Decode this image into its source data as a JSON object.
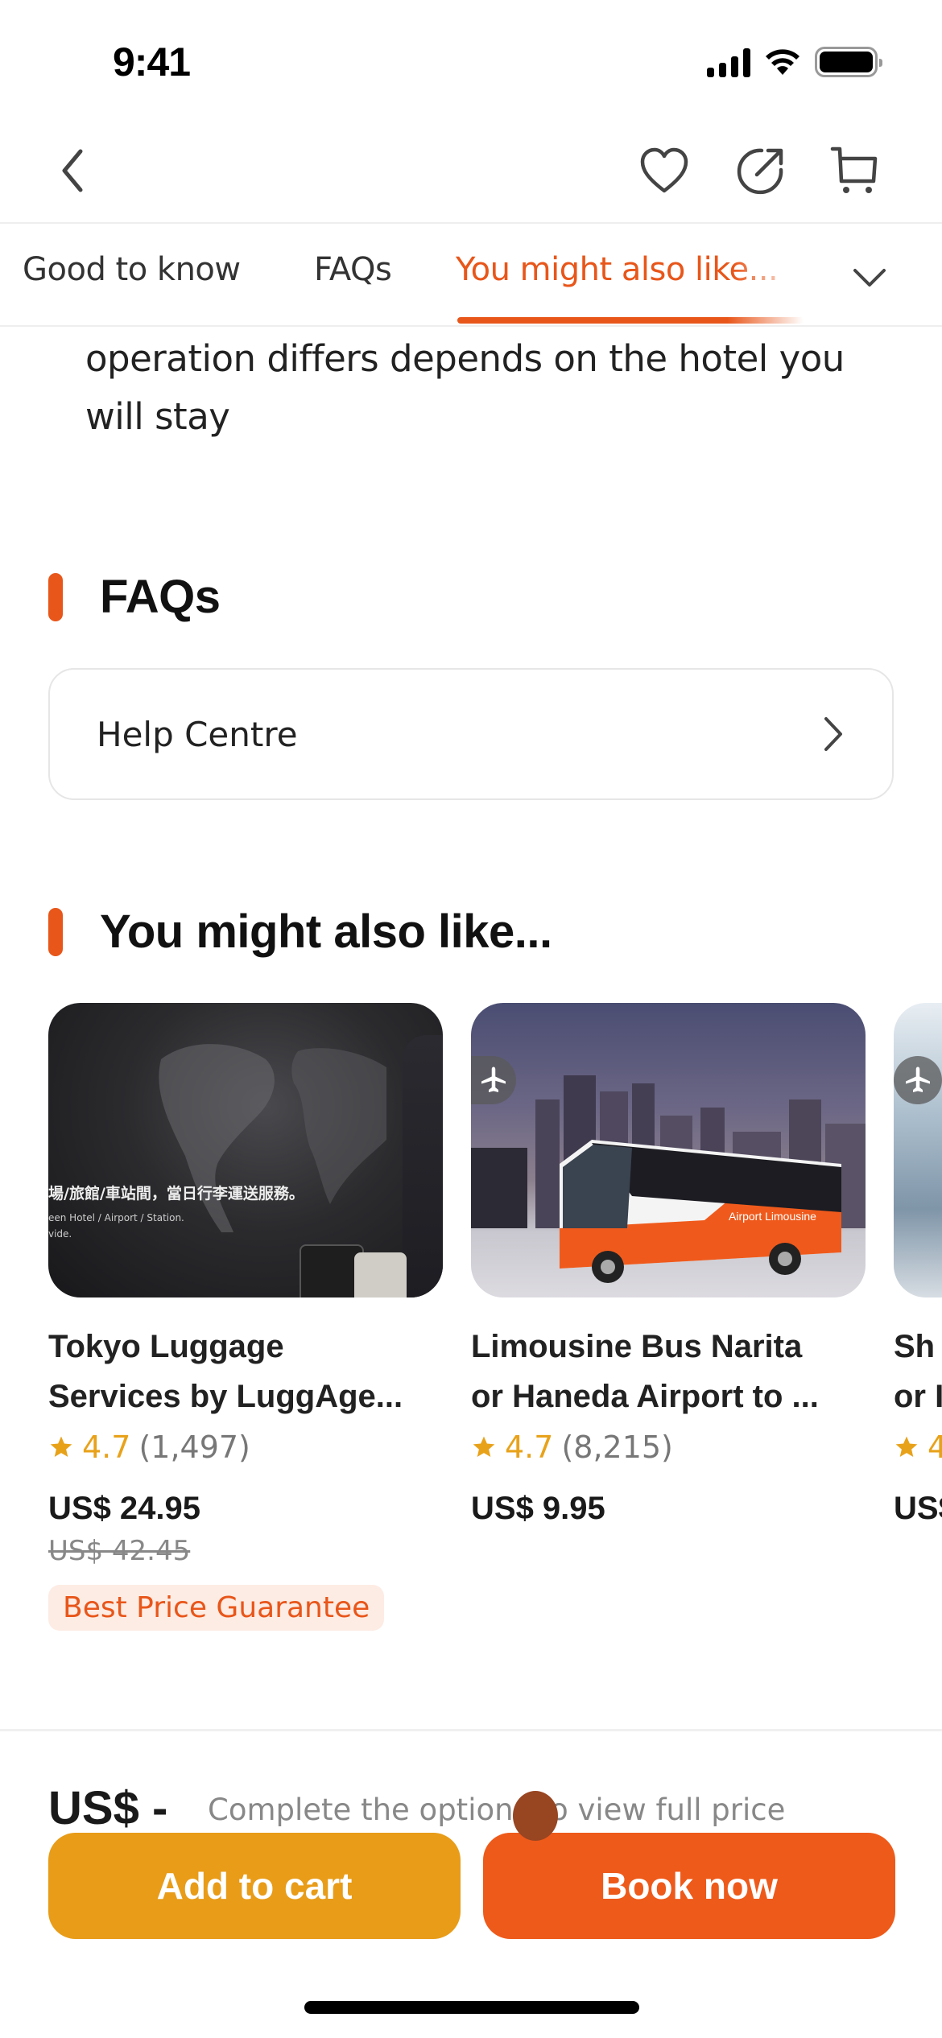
{
  "status_bar": {
    "time": "9:41"
  },
  "header": {
    "icons": [
      "back-icon",
      "heart-icon",
      "share-icon",
      "cart-icon"
    ]
  },
  "tabs": {
    "items": [
      {
        "label": "Good to know",
        "active": false
      },
      {
        "label": "FAQs",
        "active": false
      },
      {
        "label": "You might also like...",
        "active": true
      }
    ],
    "accent_color": "#e8561a"
  },
  "content": {
    "description": "operation differs depends on the hotel you will stay",
    "faq_section": {
      "title": "FAQs",
      "help_centre_label": "Help Centre"
    },
    "recommend_section": {
      "title": "You might also like...",
      "products": [
        {
          "title_line1": "Tokyo Luggage",
          "title_line2": "Services by LuggAge...",
          "rating": "4.7",
          "reviews": "(1,497)",
          "price": "US$ 24.95",
          "original_price": "US$ 42.45",
          "badge": "Best Price Guarantee",
          "image_text_cn": "場/旅館/車站間，當日行李運送服務。",
          "image_text_en1": "een Hotel / Airport / Station.",
          "image_text_en2": "vide."
        },
        {
          "title_line1": "Limousine Bus Narita",
          "title_line2": "or Haneda Airport to ...",
          "rating": "4.7",
          "reviews": "(8,215)",
          "price": "US$ 9.95"
        },
        {
          "title_line1": "Sh",
          "title_line2": "or I",
          "rating": "4",
          "price": "US$"
        }
      ]
    }
  },
  "bottom_bar": {
    "price": "US$ -",
    "price_hint": "Complete the options to view full price",
    "add_to_cart_label": "Add to cart",
    "book_now_label": "Book now",
    "add_to_cart_color": "#e89c18",
    "book_now_color": "#ee5a1a"
  }
}
